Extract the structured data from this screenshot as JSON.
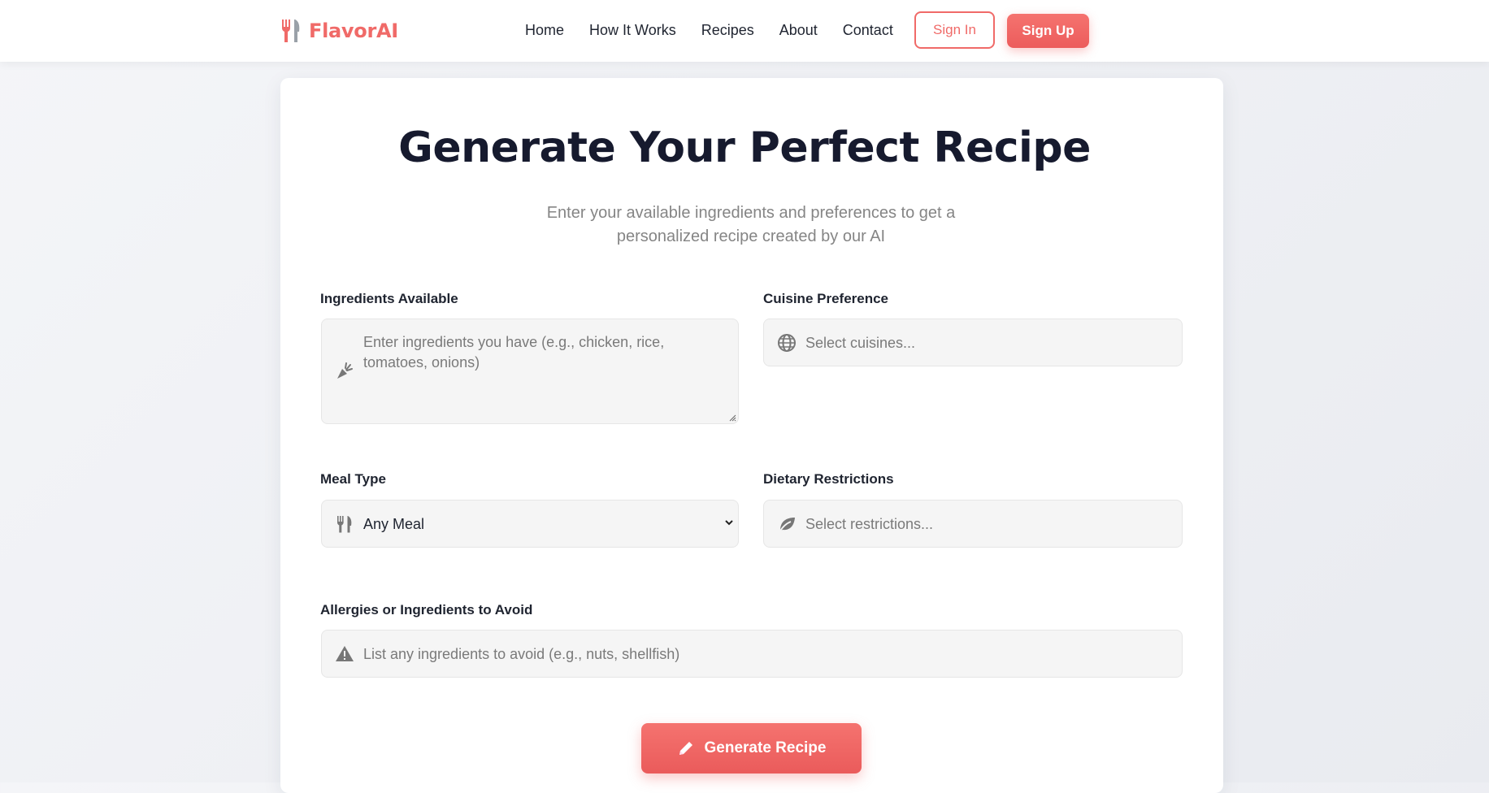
{
  "brand": {
    "name": "FlavorAI",
    "icon": "utensils-icon",
    "color": "#f06a68"
  },
  "nav": {
    "links": [
      "Home",
      "How It Works",
      "Recipes",
      "About",
      "Contact"
    ],
    "sign_in": "Sign In",
    "sign_up": "Sign Up"
  },
  "main": {
    "title": "Generate Your Perfect Recipe",
    "subtitle": "Enter your available ingredients and preferences to get a personalized recipe created by our AI"
  },
  "form": {
    "ingredients": {
      "label": "Ingredients Available",
      "placeholder": "Enter ingredients you have (e.g., chicken, rice, tomatoes, onions)",
      "icon": "carrot-icon"
    },
    "cuisine": {
      "label": "Cuisine Preference",
      "placeholder": "Select cuisines...",
      "icon": "globe-icon"
    },
    "meal_type": {
      "label": "Meal Type",
      "value": "Any Meal",
      "icon": "utensils-icon"
    },
    "dietary": {
      "label": "Dietary Restrictions",
      "placeholder": "Select restrictions...",
      "icon": "leaf-icon"
    },
    "allergies": {
      "label": "Allergies or Ingredients to Avoid",
      "placeholder": "List any ingredients to avoid (e.g., nuts, shellfish)",
      "icon": "warning-icon"
    },
    "submit": {
      "label": "Generate Recipe",
      "icon": "pencil-icon"
    }
  },
  "colors": {
    "accent": "#f06a68",
    "title": "#161a2e",
    "muted": "#858585"
  }
}
